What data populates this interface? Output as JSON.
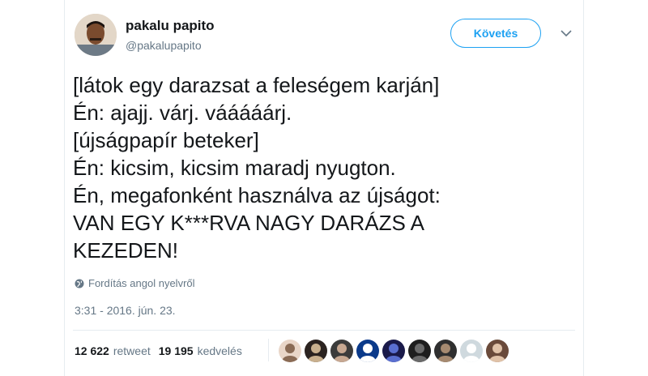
{
  "user": {
    "name": "pakalu papito",
    "handle": "@pakalupapito"
  },
  "follow_label": "Követés",
  "tweet_lines": [
    "[látok egy darazsat a feleségem karján]",
    "Én: ajajj. várj. vááááárj.",
    "[újságpapír beteker]",
    "Én: kicsim, kicsim maradj nyugton.",
    "Én, megafonként használva az újságot:",
    "VAN EGY K***RVA NAGY DARÁZS A",
    "KEZEDEN!"
  ],
  "translate_label": "Fordítás angol nyelvről",
  "timestamp": "3:31 - 2016. jún. 23.",
  "stats": {
    "retweet_count": "12 622",
    "retweet_label": "retweet",
    "like_count": "19 195",
    "like_label": "kedvelés"
  },
  "colors": {
    "accent": "#1da1f2",
    "text": "#14171a",
    "muted": "#657786",
    "divider": "#e6ecf0"
  },
  "liker_avatars": [
    {
      "bg": "#e9d6c8",
      "fg": "#8a6b55"
    },
    {
      "bg": "#2b2320",
      "fg": "#c9b08e"
    },
    {
      "bg": "#3b3b3b",
      "fg": "#c7a892"
    },
    {
      "bg": "#0b3a8a",
      "fg": "#ffffff"
    },
    {
      "bg": "#1a1a4a",
      "fg": "#5a6fd0"
    },
    {
      "bg": "#1e1e1e",
      "fg": "#6a6a6a"
    },
    {
      "bg": "#2f2f2f",
      "fg": "#a68a70"
    },
    {
      "bg": "#cfd9de",
      "fg": "#ffffff"
    },
    {
      "bg": "#6a4a3a",
      "fg": "#e0c2a8"
    }
  ]
}
